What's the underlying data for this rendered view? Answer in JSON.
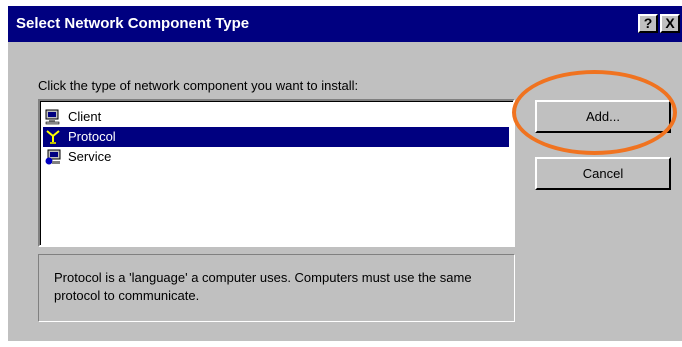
{
  "window": {
    "title": "Select Network Component Type",
    "help_label": "?",
    "close_label": "X"
  },
  "instruction": "Click the type of network component you want to install:",
  "components": [
    {
      "label": "Client",
      "icon": "client-icon",
      "selected": false
    },
    {
      "label": "Protocol",
      "icon": "protocol-icon",
      "selected": true
    },
    {
      "label": "Service",
      "icon": "service-icon",
      "selected": false
    }
  ],
  "buttons": {
    "add_label": "Add...",
    "cancel_label": "Cancel"
  },
  "description": "Protocol is a 'language' a computer uses. Computers must use the same protocol to communicate.",
  "colors": {
    "titlebar": "#000080",
    "selection": "#000080",
    "face": "#c0c0c0",
    "highlight_ring": "#f07320"
  }
}
